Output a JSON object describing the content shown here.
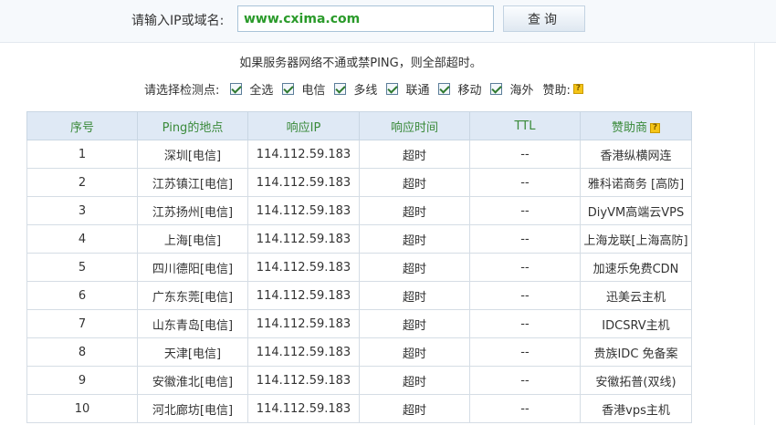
{
  "query": {
    "label": "请输入IP或域名:",
    "value": "www.cxima.com",
    "button": "查询"
  },
  "notice": "如果服务器网络不通或禁PING，则全部超时。",
  "nodes": {
    "label": "请选择检测点:",
    "options": [
      "全选",
      "电信",
      "多线",
      "联通",
      "移动",
      "海外"
    ],
    "sponsor_label": "赞助:",
    "help_icon": "question-icon"
  },
  "table": {
    "headers": [
      "序号",
      "Ping的地点",
      "响应IP",
      "响应时间",
      "TTL",
      "赞助商"
    ],
    "rows": [
      {
        "no": "1",
        "location": "深圳[电信]",
        "ip": "114.112.59.183",
        "time": "超时",
        "ttl": "--",
        "sponsor": "香港纵横网连"
      },
      {
        "no": "2",
        "location": "江苏镇江[电信]",
        "ip": "114.112.59.183",
        "time": "超时",
        "ttl": "--",
        "sponsor": "雅科诺商务 [高防]"
      },
      {
        "no": "3",
        "location": "江苏扬州[电信]",
        "ip": "114.112.59.183",
        "time": "超时",
        "ttl": "--",
        "sponsor": "DiyVM高端云VPS"
      },
      {
        "no": "4",
        "location": "上海[电信]",
        "ip": "114.112.59.183",
        "time": "超时",
        "ttl": "--",
        "sponsor": "上海龙联[上海高防]"
      },
      {
        "no": "5",
        "location": "四川德阳[电信]",
        "ip": "114.112.59.183",
        "time": "超时",
        "ttl": "--",
        "sponsor": "加速乐免费CDN"
      },
      {
        "no": "6",
        "location": "广东东莞[电信]",
        "ip": "114.112.59.183",
        "time": "超时",
        "ttl": "--",
        "sponsor": "迅美云主机"
      },
      {
        "no": "7",
        "location": "山东青岛[电信]",
        "ip": "114.112.59.183",
        "time": "超时",
        "ttl": "--",
        "sponsor": "IDCSRV主机"
      },
      {
        "no": "8",
        "location": "天津[电信]",
        "ip": "114.112.59.183",
        "time": "超时",
        "ttl": "--",
        "sponsor": "贵族IDC 免备案"
      },
      {
        "no": "9",
        "location": "安徽淮北[电信]",
        "ip": "114.112.59.183",
        "time": "超时",
        "ttl": "--",
        "sponsor": "安徽拓普(双线)"
      },
      {
        "no": "10",
        "location": "河北廊坊[电信]",
        "ip": "114.112.59.183",
        "time": "超时",
        "ttl": "--",
        "sponsor": "香港vps主机"
      }
    ]
  }
}
